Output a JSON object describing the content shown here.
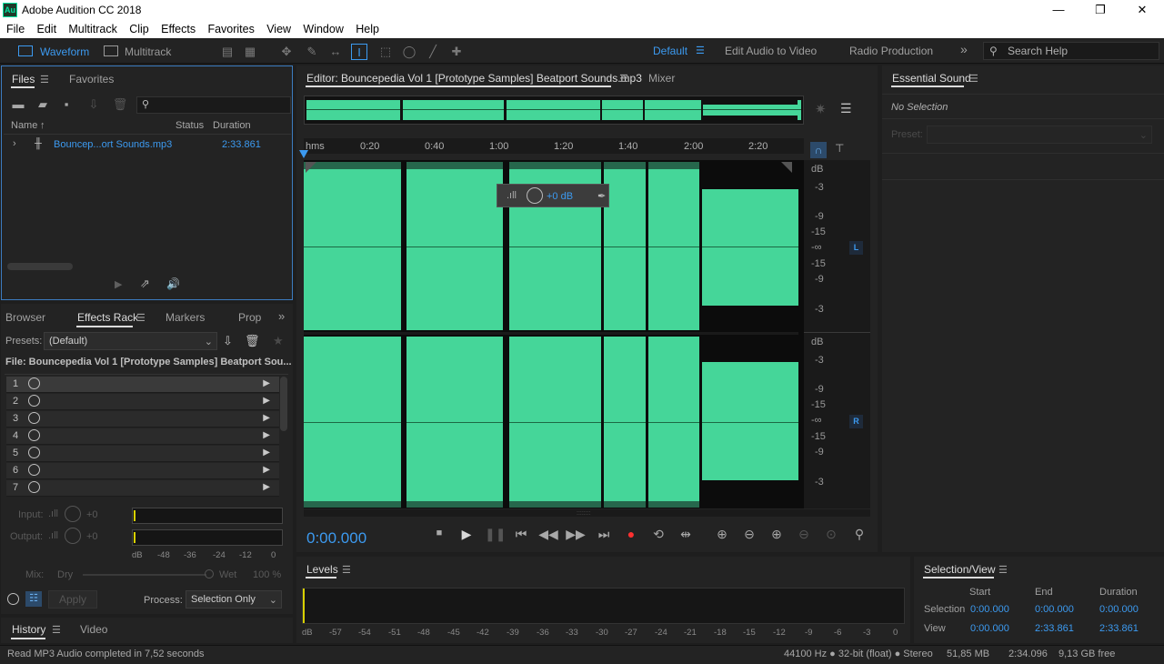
{
  "app": {
    "title": "Adobe Audition CC 2018",
    "icon_text": "Au"
  },
  "window_controls": {
    "minimize": "—",
    "maximize": "❐",
    "close": "✕"
  },
  "menu": [
    "File",
    "Edit",
    "Multitrack",
    "Clip",
    "Effects",
    "Favorites",
    "View",
    "Window",
    "Help"
  ],
  "toolbar": {
    "waveform": "Waveform",
    "multitrack": "Multitrack",
    "workspaces": [
      "Default",
      "Edit Audio to Video",
      "Radio Production"
    ],
    "more": "»",
    "search_placeholder": "Search Help"
  },
  "files_panel": {
    "tabs": [
      "Files",
      "Favorites"
    ],
    "columns": {
      "name": "Name",
      "status": "Status",
      "duration": "Duration"
    },
    "items": [
      {
        "name": "Bouncep...ort Sounds.mp3",
        "duration": "2:33.861"
      }
    ]
  },
  "effects_panel": {
    "tabs": [
      "Browser",
      "Effects Rack",
      "Markers",
      "Prop"
    ],
    "presets_label": "Presets:",
    "preset_value": "(Default)",
    "file_line": "File: Bouncepedia Vol 1 [Prototype Samples] Beatport Sou...",
    "slots": [
      "1",
      "2",
      "3",
      "4",
      "5",
      "6",
      "7"
    ],
    "input_label": "Input:",
    "input_value": "+0",
    "output_label": "Output:",
    "output_value": "+0",
    "meter_ticks": [
      "dB",
      "-48",
      "-36",
      "-24",
      "-12",
      "0"
    ],
    "mix_label": "Mix:",
    "dry_label": "Dry",
    "wet_label": "Wet",
    "wet_value": "100 %",
    "apply": "Apply",
    "process_label": "Process:",
    "process_value": "Selection Only"
  },
  "history_panel": {
    "tabs": [
      "History",
      "Video"
    ]
  },
  "editor": {
    "tab": "Editor: Bouncepedia Vol 1 [Prototype Samples] Beatport Sounds.mp3",
    "mixer": "Mixer",
    "ruler": [
      "hms",
      "0:20",
      "0:40",
      "1:00",
      "1:20",
      "1:40",
      "2:00",
      "2:20"
    ],
    "hud_gain": "+0 dB",
    "db_scale_top": [
      "dB",
      "-3",
      "-9",
      "-15",
      "-∞",
      "-15",
      "-9",
      "-3"
    ],
    "db_scale_bottom": [
      "dB",
      "-3",
      "-9",
      "-15",
      "-∞",
      "-15",
      "-9",
      "-3"
    ],
    "channel_left": "L",
    "channel_right": "R",
    "time": "0:00.000",
    "waveform_color": "#45d699"
  },
  "levels": {
    "title": "Levels",
    "ticks": [
      "dB",
      "-57",
      "-54",
      "-51",
      "-48",
      "-45",
      "-42",
      "-39",
      "-36",
      "-33",
      "-30",
      "-27",
      "-24",
      "-21",
      "-18",
      "-15",
      "-12",
      "-9",
      "-6",
      "-3",
      "0"
    ]
  },
  "essential_sound": {
    "title": "Essential Sound",
    "no_selection": "No Selection",
    "preset_label": "Preset:"
  },
  "selection_view": {
    "title": "Selection/View",
    "headers": [
      "Start",
      "End",
      "Duration"
    ],
    "selection_label": "Selection",
    "selection": [
      "0:00.000",
      "0:00.000",
      "0:00.000"
    ],
    "view_label": "View",
    "view": [
      "0:00.000",
      "2:33.861",
      "2:33.861"
    ]
  },
  "status": {
    "message": "Read MP3 Audio completed in 7,52 seconds",
    "format": "44100 Hz ● 32-bit (float) ● Stereo",
    "size": "51,85 MB",
    "duration": "2:34.096",
    "free": "9,13 GB free"
  }
}
